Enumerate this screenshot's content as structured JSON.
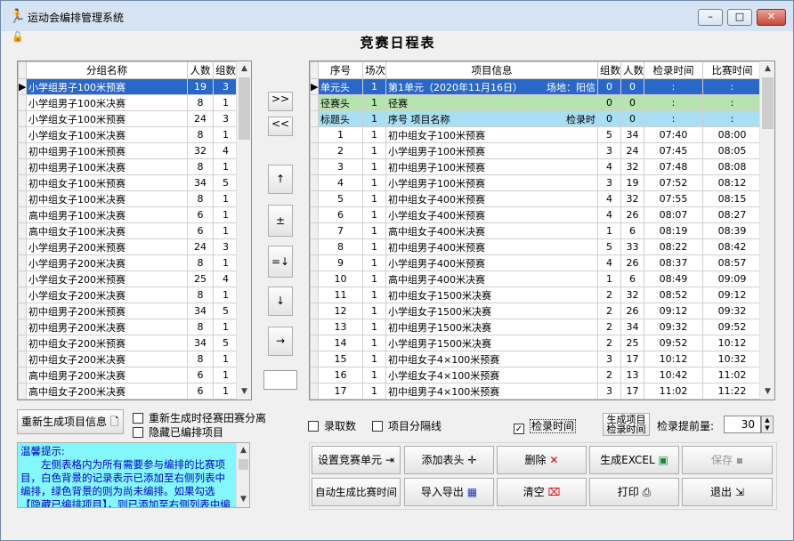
{
  "window": {
    "title": "运动会编排管理系统",
    "min": "–",
    "max": "□",
    "close": "✕",
    "app_icon": "runner-icon"
  },
  "heading": "竞赛日程表",
  "left_grid": {
    "headers": [
      "分组名称",
      "人数",
      "组数"
    ],
    "rows": [
      [
        "小学组男子100米预赛",
        "19",
        "3"
      ],
      [
        "小学组男子100米决赛",
        "8",
        "1"
      ],
      [
        "小学组女子100米预赛",
        "24",
        "3"
      ],
      [
        "小学组女子100米决赛",
        "8",
        "1"
      ],
      [
        "初中组男子100米预赛",
        "32",
        "4"
      ],
      [
        "初中组男子100米决赛",
        "8",
        "1"
      ],
      [
        "初中组女子100米预赛",
        "34",
        "5"
      ],
      [
        "初中组女子100米决赛",
        "8",
        "1"
      ],
      [
        "高中组男子100米决赛",
        "6",
        "1"
      ],
      [
        "高中组女子100米决赛",
        "6",
        "1"
      ],
      [
        "小学组男子200米预赛",
        "24",
        "3"
      ],
      [
        "小学组男子200米决赛",
        "8",
        "1"
      ],
      [
        "小学组女子200米预赛",
        "25",
        "4"
      ],
      [
        "小学组女子200米决赛",
        "8",
        "1"
      ],
      [
        "初中组男子200米预赛",
        "34",
        "5"
      ],
      [
        "初中组男子200米决赛",
        "8",
        "1"
      ],
      [
        "初中组女子200米预赛",
        "34",
        "5"
      ],
      [
        "初中组女子200米决赛",
        "8",
        "1"
      ],
      [
        "高中组男子200米决赛",
        "6",
        "1"
      ],
      [
        "高中组女子200米决赛",
        "6",
        "1"
      ]
    ]
  },
  "mid_buttons": [
    ">>",
    "<<",
    "↑",
    "±",
    "=↓",
    "↓",
    "→"
  ],
  "right_grid": {
    "headers": [
      "序号",
      "场次",
      "项目信息",
      "组数",
      "人数",
      "检录时间",
      "比赛时间"
    ],
    "special_rows": [
      {
        "seq": "单元头",
        "round": "1",
        "info": "第1单元（2020年11月16日）",
        "venue": "场地：阳信",
        "groups": "0",
        "people": "0",
        "check": ":",
        "match": ":"
      },
      {
        "seq": "径赛头",
        "round": "1",
        "info": "径赛",
        "venue": "",
        "groups": "0",
        "people": "0",
        "check": ":",
        "match": ":"
      },
      {
        "seq": "标题头",
        "round": "1",
        "info": "序号  项目名称",
        "venue": "检录时",
        "groups": "0",
        "people": "0",
        "check": ":",
        "match": ":"
      }
    ],
    "rows": [
      [
        "1",
        "1",
        "初中组女子100米预赛",
        "5",
        "34",
        "07:40",
        "08:00"
      ],
      [
        "2",
        "1",
        "小学组男子100米预赛",
        "3",
        "24",
        "07:45",
        "08:05"
      ],
      [
        "3",
        "1",
        "初中组男子100米预赛",
        "4",
        "32",
        "07:48",
        "08:08"
      ],
      [
        "4",
        "1",
        "小学组男子100米预赛",
        "3",
        "19",
        "07:52",
        "08:12"
      ],
      [
        "5",
        "1",
        "初中组女子400米预赛",
        "4",
        "32",
        "07:55",
        "08:15"
      ],
      [
        "6",
        "1",
        "小学组女子400米预赛",
        "4",
        "26",
        "08:07",
        "08:27"
      ],
      [
        "7",
        "1",
        "高中组女子400米决赛",
        "1",
        "6",
        "08:19",
        "08:39"
      ],
      [
        "8",
        "1",
        "初中组男子400米预赛",
        "5",
        "33",
        "08:22",
        "08:42"
      ],
      [
        "9",
        "1",
        "小学组男子400米预赛",
        "4",
        "26",
        "08:37",
        "08:57"
      ],
      [
        "10",
        "1",
        "高中组男子400米决赛",
        "1",
        "6",
        "08:49",
        "09:09"
      ],
      [
        "11",
        "1",
        "初中组女子1500米决赛",
        "2",
        "32",
        "08:52",
        "09:12"
      ],
      [
        "12",
        "1",
        "小学组女子1500米决赛",
        "2",
        "26",
        "09:12",
        "09:32"
      ],
      [
        "13",
        "1",
        "初中组男子1500米决赛",
        "2",
        "34",
        "09:32",
        "09:52"
      ],
      [
        "14",
        "1",
        "小学组男子1500米决赛",
        "2",
        "25",
        "09:52",
        "10:12"
      ],
      [
        "15",
        "1",
        "初中组女子4×100米预赛",
        "3",
        "17",
        "10:12",
        "10:32"
      ],
      [
        "16",
        "1",
        "小学组女子4×100米预赛",
        "2",
        "13",
        "10:42",
        "11:02"
      ],
      [
        "17",
        "1",
        "初中组男子4×100米预赛",
        "3",
        "17",
        "11:02",
        "11:22"
      ]
    ]
  },
  "controls": {
    "regen_button": "重新生成项目信息",
    "opt_separate": "重新生成时径赛田赛分离",
    "opt_hide": "隐藏已编排项目",
    "opt_record": "录取数",
    "opt_divider": "项目分隔线",
    "opt_checktime": "检录时间",
    "gen_check_button_1": "生成项目",
    "gen_check_button_2": "检录时间",
    "advance_label": "检录提前量:",
    "advance_value": "30"
  },
  "hint": {
    "title": "温馨提示:",
    "text": "　　左侧表格内为所有需要参与编排的比赛项目，白色背景的记录表示已添加至右侧列表中编排，绿色背景的则为尚未编排。如果勾选【隐藏已编排项目】，则已添加至右侧列表中编"
  },
  "actions": {
    "set_unit": "设置竞赛单元",
    "add_header": "添加表头",
    "delete": "删除",
    "gen_excel": "生成EXCEL",
    "save": "保存",
    "auto_time": "自动生成比赛时间",
    "import_export": "导入导出",
    "clear": "清空",
    "print": "打印",
    "exit": "退出"
  }
}
